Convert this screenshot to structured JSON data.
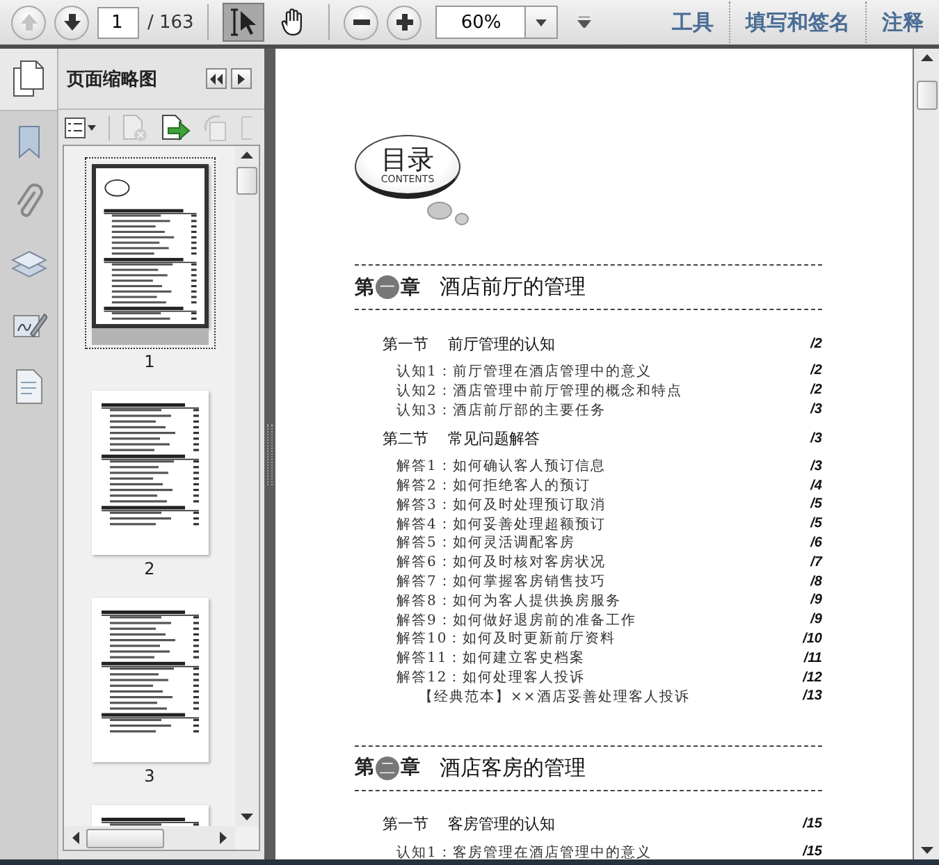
{
  "toolbar": {
    "nav_buttons": [
      {
        "kind": "prev",
        "disabled": true
      },
      {
        "kind": "next",
        "disabled": false
      }
    ],
    "page_number": "1",
    "page_total": "/ 163",
    "tools": [
      {
        "kind": "select",
        "selected": true
      },
      {
        "kind": "hand",
        "selected": false
      }
    ],
    "zoom_value": "60%",
    "links": [
      "工具",
      "填写和签名",
      "注释"
    ]
  },
  "rail": [
    {
      "kind": "pages",
      "selected": true
    },
    {
      "kind": "bookmarks",
      "selected": false
    },
    {
      "kind": "attachments",
      "selected": false
    },
    {
      "kind": "layers",
      "selected": false
    },
    {
      "kind": "signatures",
      "selected": false
    },
    {
      "kind": "content",
      "selected": false
    }
  ],
  "thumbnail_panel": {
    "title": "页面缩略图",
    "actions": [
      {
        "kind": "options",
        "disabled": false
      },
      {
        "kind": "delete",
        "disabled": true
      },
      {
        "kind": "extract",
        "disabled": false
      },
      {
        "kind": "rotate",
        "disabled": true
      },
      {
        "kind": "crop",
        "disabled": true
      }
    ],
    "thumbnails": [
      {
        "label": "1",
        "selected": true
      },
      {
        "label": "2",
        "selected": false
      },
      {
        "label": "3",
        "selected": false
      },
      {
        "selected": false
      }
    ]
  },
  "document": {
    "title": "目录",
    "subtitle": "CONTENTS",
    "chapters": [
      {
        "prefix": "第",
        "number": "一",
        "suffix": "章",
        "title": "酒店前厅的管理",
        "sections": [
          {
            "label": "第一节",
            "title": "前厅管理的认知",
            "page": "/2",
            "entries": [
              {
                "kind": "item",
                "text": "认知1：前厅管理在酒店管理中的意义",
                "page": "/2"
              },
              {
                "kind": "item",
                "text": "认知2：酒店管理中前厅管理的概念和特点",
                "page": "/2"
              },
              {
                "kind": "item",
                "text": "认知3：酒店前厅部的主要任务",
                "page": "/3"
              }
            ]
          },
          {
            "label": "第二节",
            "title": "常见问题解答",
            "page": "/3",
            "entries": [
              {
                "kind": "item",
                "text": "解答1：如何确认客人预订信息",
                "page": "/3"
              },
              {
                "kind": "item",
                "text": "解答2：如何拒绝客人的预订",
                "page": "/4"
              },
              {
                "kind": "item",
                "text": "解答3：如何及时处理预订取消",
                "page": "/5"
              },
              {
                "kind": "item",
                "text": "解答4：如何妥善处理超额预订",
                "page": "/5"
              },
              {
                "kind": "item",
                "text": "解答5：如何灵活调配客房",
                "page": "/6"
              },
              {
                "kind": "item",
                "text": "解答6：如何及时核对客房状况",
                "page": "/7"
              },
              {
                "kind": "item",
                "text": "解答7：如何掌握客房销售技巧",
                "page": "/8"
              },
              {
                "kind": "item",
                "text": "解答8：如何为客人提供换房服务",
                "page": "/9"
              },
              {
                "kind": "item",
                "text": "解答9：如何做好退房前的准备工作",
                "page": "/9"
              },
              {
                "kind": "item",
                "text": "解答10：如何及时更新前厅资料",
                "page": "/10"
              },
              {
                "kind": "item",
                "text": "解答11：如何建立客史档案",
                "page": "/11"
              },
              {
                "kind": "item",
                "text": "解答12：如何处理客人投诉",
                "page": "/12"
              },
              {
                "kind": "sample",
                "text": "【经典范本】××酒店妥善处理客人投诉",
                "page": "/13"
              }
            ]
          }
        ]
      },
      {
        "prefix": "第",
        "number": "二",
        "suffix": "章",
        "title": "酒店客房的管理",
        "sections": [
          {
            "label": "第一节",
            "title": "客房管理的认知",
            "page": "/15",
            "entries": [
              {
                "kind": "item",
                "text": "认知1：客房管理在酒店管理中的意义",
                "page": "/15"
              }
            ]
          }
        ]
      }
    ]
  }
}
